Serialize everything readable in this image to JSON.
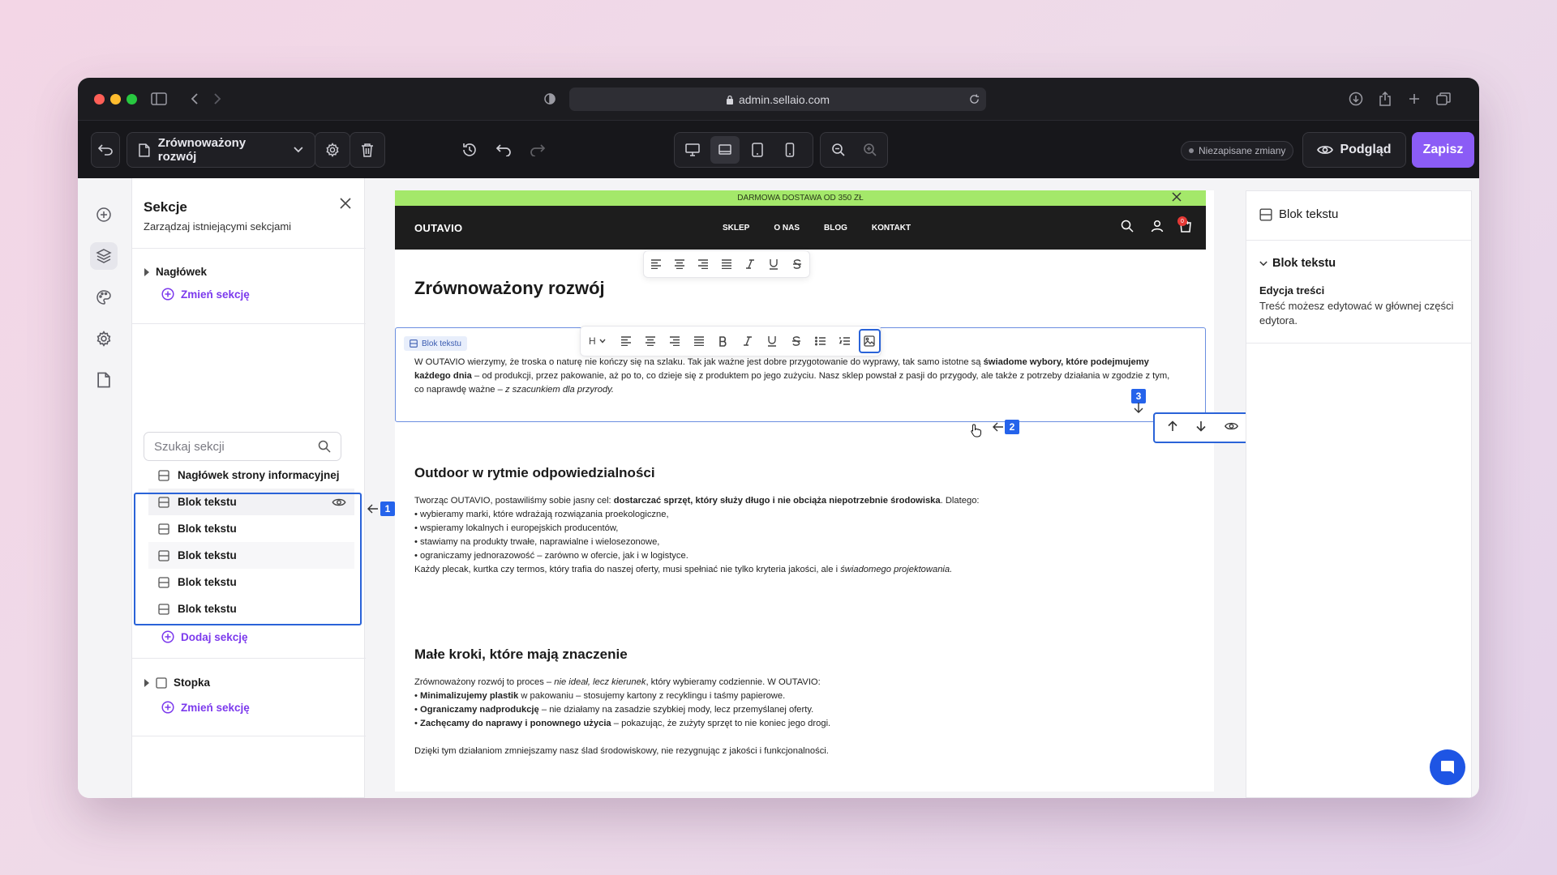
{
  "browser": {
    "url": "admin.sellaio.com"
  },
  "toolbar": {
    "page_name": "Zrównoważony rozwój",
    "unsaved": "Niezapisane zmiany",
    "preview": "Podgląd",
    "save": "Zapisz"
  },
  "sidebar": {
    "title": "Sekcje",
    "subtitle": "Zarządzaj istniejącymi sekcjami",
    "header_section": "Nagłówek",
    "change_section": "Zmień sekcję",
    "search_placeholder": "Szukaj sekcji",
    "items": [
      {
        "label": "Nagłówek strony informacyjnej"
      },
      {
        "label": "Blok tekstu"
      },
      {
        "label": "Blok tekstu"
      },
      {
        "label": "Blok tekstu"
      },
      {
        "label": "Blok tekstu"
      },
      {
        "label": "Blok tekstu"
      }
    ],
    "add_section": "Dodaj sekcję",
    "footer_section": "Stopka",
    "change_section_2": "Zmień sekcję"
  },
  "markers": [
    "1",
    "2",
    "3"
  ],
  "store": {
    "promo": "DARMOWA DOSTAWA OD 350 ZŁ",
    "logo": "OUTAVIO",
    "menu": [
      "SKLEP",
      "O NAS",
      "BLOG",
      "KONTAKT"
    ],
    "cart_count": "0",
    "heading_level": "H",
    "block_label": "Blok tekstu",
    "page_title": "Zrównoważony rozwój",
    "p1_a": "W OUTAVIO wierzymy, że troska o naturę nie kończy się na szlaku. Tak jak ważne jest dobre przygotowanie do wyprawy, tak samo istotne są ",
    "p1_b": "świadome wybory, które podejmujemy każdego dnia",
    "p1_c": " – od produkcji, przez pakowanie, aż po to, co dzieje się z produktem po jego zużyciu. Nasz sklep powstał z pasji do przygody, ale także z potrzeby działania w zgodzie z tym, co naprawdę ważne – ",
    "p1_d": "z szacunkiem dla przyrody.",
    "h2a": "Outdoor w rytmie odpowiedzialności",
    "p2_a": "Tworząc OUTAVIO, postawiliśmy sobie jasny cel: ",
    "p2_b": "dostarczać sprzęt, który służy długo i nie obciąża niepotrzebnie środowiska",
    "p2_c": ". Dlatego:",
    "list1": [
      "wybieramy marki, które wdrażają rozwiązania proekologiczne,",
      "wspieramy lokalnych i europejskich producentów,",
      "stawiamy na produkty trwałe, naprawialne i wielosezonowe,",
      "ograniczamy jednorazowość – zarówno w ofercie, jak i w logistyce."
    ],
    "p3_a": "Każdy plecak, kurtka czy termos, który trafia do naszej oferty, musi spełniać nie tylko kryteria jakości, ale i ",
    "p3_b": "świadomego projektowania.",
    "h2b": "Małe kroki, które mają znaczenie",
    "p4_a": "Zrównoważony rozwój to proces – ",
    "p4_b": "nie ideał, lecz kierunek",
    "p4_c": ", który wybieramy codziennie. W OUTAVIO:",
    "list2": [
      {
        "b": "Minimalizujemy plastik",
        "t": " w pakowaniu – stosujemy kartony z recyklingu i taśmy papierowe."
      },
      {
        "b": "Ograniczamy nadprodukcję",
        "t": " – nie działamy na zasadzie szybkiej mody, lecz przemyślanej oferty."
      },
      {
        "b": "Zachęcamy do naprawy i ponownego użycia",
        "t": " – pokazując, że zużyty sprzęt to nie koniec jego drogi."
      }
    ],
    "p5": "Dzięki tym działaniom zmniejszamy nasz ślad środowiskowy, nie rezygnując z jakości i funkcjonalności."
  },
  "inspector": {
    "title": "Blok tekstu",
    "section": "Blok tekstu",
    "label": "Edycja treści",
    "text": "Treść możesz edytować w głównej części edytora."
  }
}
